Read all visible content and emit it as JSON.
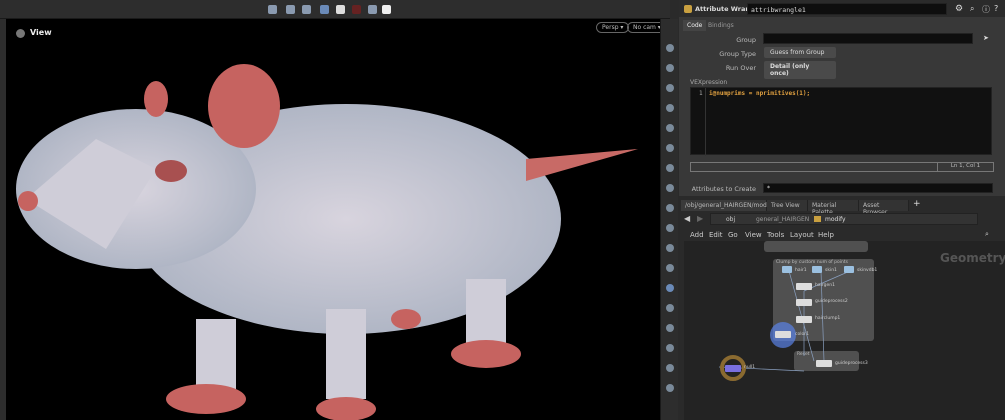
{
  "viewport": {
    "title": "View",
    "persp": "Persp ▾",
    "cam": "No cam ▾"
  },
  "params": {
    "node_type": "Attribute Wrangle",
    "node_name": "attribwrangle1",
    "tabs": [
      "Code",
      "Bindings"
    ],
    "group_label": "Group",
    "group_value": "",
    "group_type_label": "Group Type",
    "group_type_value": "Guess from Group",
    "run_over_label": "Run Over",
    "run_over_value": "Detail (only once)",
    "vex_label": "VEXpression",
    "line_no": "1",
    "code": "i@numprims = nprimitives(1);",
    "cursor_pos": "Ln 1, Col 1",
    "attr_create_label": "Attributes to Create",
    "attr_create_value": "*"
  },
  "network": {
    "tabs": [
      "/obj/general_HAIRGEN/modify",
      "Tree View",
      "Material Palette",
      "Asset Browser"
    ],
    "path": [
      "obj",
      "general_HAIRGEN",
      "modify"
    ],
    "menu": [
      "Add",
      "Edit",
      "Go",
      "View",
      "Tools",
      "Layout",
      "Help"
    ],
    "context_label": "Geometry",
    "box1_label": "Clump by custom num of points",
    "box2_label": "Reset",
    "nodes": [
      "hair1",
      "skin1",
      "skinvdb1",
      "hairgen1",
      "guideprocess2",
      "hairclump1",
      "color1",
      "guideprocess3",
      "null1"
    ]
  }
}
